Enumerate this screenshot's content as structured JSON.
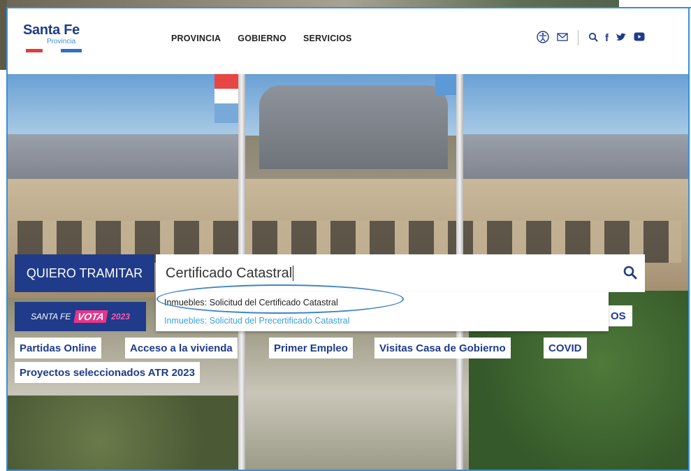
{
  "header": {
    "logo_title": "Santa Fe",
    "logo_sub": "Provincia",
    "nav": [
      "PROVINCIA",
      "GOBIERNO",
      "SERVICIOS"
    ],
    "icons": [
      "accessibility-icon",
      "mail-icon",
      "search-icon",
      "facebook-icon",
      "twitter-icon",
      "youtube-icon"
    ]
  },
  "search": {
    "label": "QUIERO TRAMITAR",
    "value": "Certificado Catastral",
    "suggestions": [
      "Inmuebles: Solicitud del Certificado Catastral",
      "Inmuebles: Solicitud del Precertificado Catastral"
    ]
  },
  "banner": {
    "prefix": "SANTA FE",
    "badge": "VOTA",
    "year": "2023"
  },
  "quick_links": {
    "partial": "OS",
    "row1": [
      "Partidas Online",
      "Acceso a la vivienda",
      "Primer Empleo",
      "Visitas Casa de Gobierno",
      "COVID"
    ],
    "row2": [
      "Proyectos seleccionados ATR 2023"
    ]
  },
  "colors": {
    "brand_navy": "#1f3b8a",
    "brand_blue": "#3b8fd6",
    "brand_red": "#e13c3c",
    "vota_pink": "#e8358a",
    "suggestion_link": "#3aa2d9"
  }
}
